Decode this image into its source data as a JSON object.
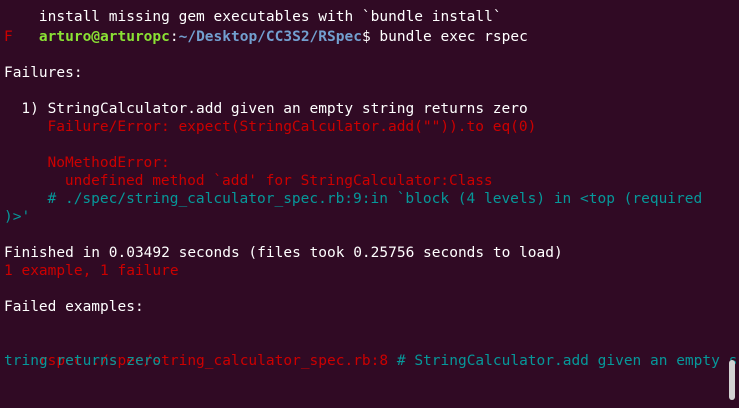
{
  "terminal": {
    "top_cut_line": "install missing gem executables with `bundle install`",
    "prompt_user": "arturo@arturopc",
    "prompt_sep": ":",
    "prompt_path": "~/Desktop/CC3S2/RSpec",
    "prompt_symbol": "$ ",
    "command": "bundle exec rspec",
    "progress": "F",
    "failures_heading": "Failures:",
    "failure_1": {
      "title": "1) StringCalculator.add given an empty string returns zero",
      "error_line": "Failure/Error: expect(StringCalculator.add(\"\")).to eq(0)",
      "exception": "NoMethodError:",
      "message": "undefined method `add' for StringCalculator:Class",
      "backtrace_1": "# ./spec/string_calculator_spec.rb:9:in `block (4 levels) in <top (required",
      "backtrace_2": ")>'"
    },
    "finished": "Finished in 0.03492 seconds (files took 0.25756 seconds to load)",
    "summary": "1 example, 1 failure",
    "failed_examples_heading": "Failed examples:",
    "failed_cmd": "rspec ./spec/string_calculator_spec.rb:8",
    "failed_desc_1": " # StringCalculator.add given an empty s",
    "failed_desc_2": "tring returns zero"
  },
  "colors": {
    "background": "#300a24",
    "prompt_user": "#8ae234",
    "prompt_path": "#729fcf",
    "error": "#cc0000",
    "comment": "#06989a"
  }
}
